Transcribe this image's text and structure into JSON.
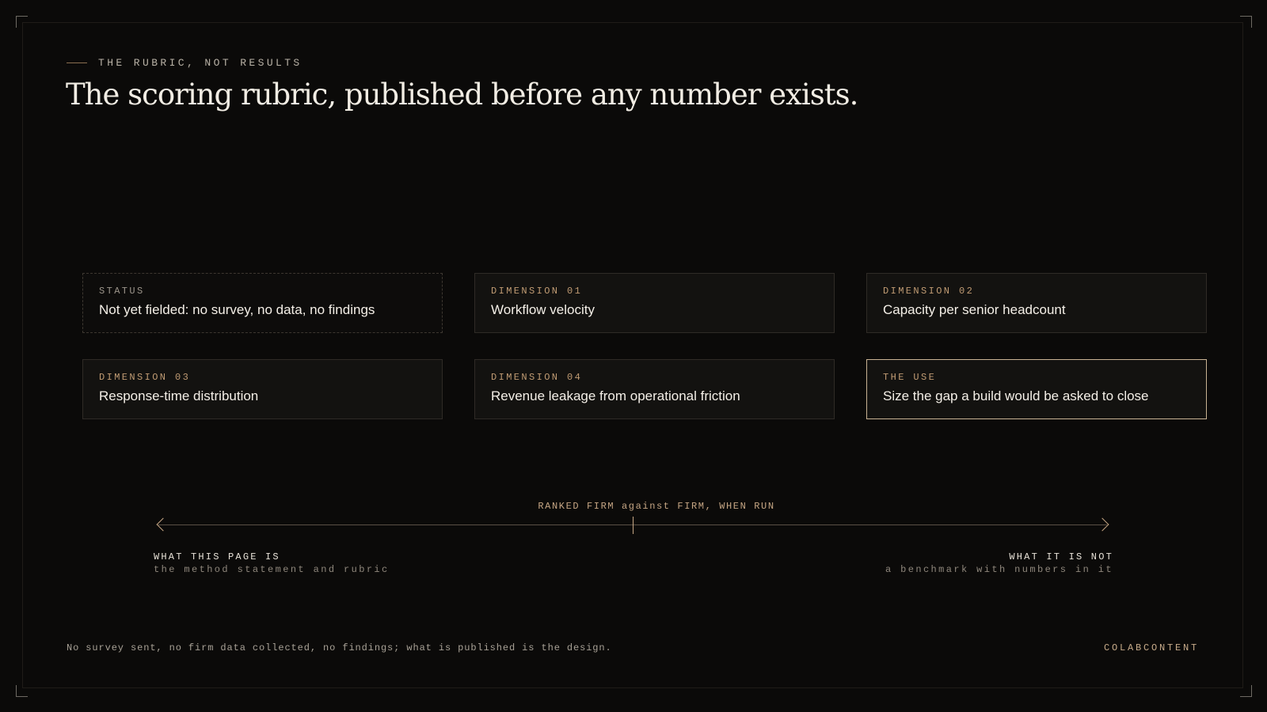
{
  "header": {
    "eyebrow": "THE RUBRIC, NOT RESULTS",
    "title": "The scoring rubric, published before any number exists."
  },
  "cards": [
    {
      "label": "STATUS",
      "value": "Not yet fielded: no survey, no data, no findings"
    },
    {
      "label": "DIMENSION 01",
      "value": "Workflow velocity"
    },
    {
      "label": "DIMENSION 02",
      "value": "Capacity per senior headcount"
    },
    {
      "label": "DIMENSION 03",
      "value": "Response-time distribution"
    },
    {
      "label": "DIMENSION 04",
      "value": "Revenue leakage from operational friction"
    },
    {
      "label": "THE USE",
      "value": "Size the gap a build would be asked to close"
    }
  ],
  "axis": {
    "title": "RANKED FIRM against FIRM, WHEN RUN",
    "left": {
      "title": "WHAT THIS PAGE IS",
      "sub": "the method statement and rubric"
    },
    "right": {
      "title": "WHAT IT IS NOT",
      "sub": "a benchmark with numbers in it"
    }
  },
  "footer": {
    "note": "No survey sent, no firm data collected, no findings; what is published is the design.",
    "brand": "COLABCONTENT"
  },
  "colors": {
    "background": "#0b0a09",
    "accent": "#c09b73",
    "accent_border": "#c9b394",
    "card_border": "#2f2b26",
    "text": "#f4efe7"
  }
}
